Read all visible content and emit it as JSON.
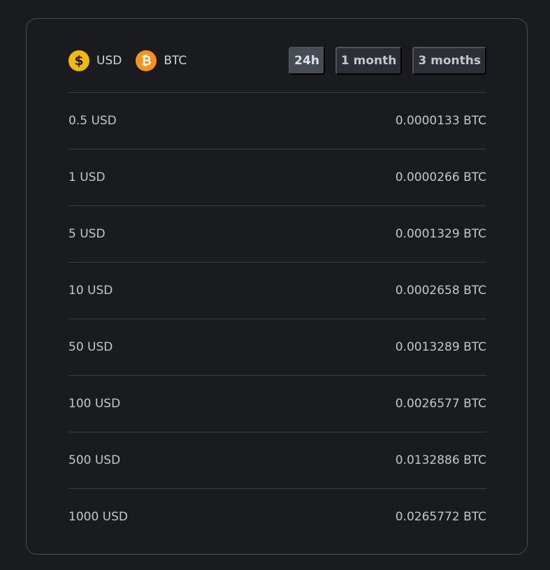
{
  "pair": {
    "from": {
      "label": "USD",
      "icon": "dollar-icon",
      "glyph": "$",
      "color": "#f0b90b"
    },
    "to": {
      "label": "BTC",
      "icon": "bitcoin-icon",
      "glyph": "₿",
      "color": "#f7931a"
    }
  },
  "periods": [
    {
      "label": "24h",
      "active": true
    },
    {
      "label": "1 month",
      "active": false
    },
    {
      "label": "3 months",
      "active": false
    }
  ],
  "rows": [
    {
      "from": "0.5 USD",
      "to": "0.0000133 BTC"
    },
    {
      "from": "1 USD",
      "to": "0.0000266 BTC"
    },
    {
      "from": "5 USD",
      "to": "0.0001329 BTC"
    },
    {
      "from": "10 USD",
      "to": "0.0002658 BTC"
    },
    {
      "from": "50 USD",
      "to": "0.0013289 BTC"
    },
    {
      "from": "100 USD",
      "to": "0.0026577 BTC"
    },
    {
      "from": "500 USD",
      "to": "0.0132886 BTC"
    },
    {
      "from": "1000 USD",
      "to": "0.0265772 BTC"
    }
  ]
}
